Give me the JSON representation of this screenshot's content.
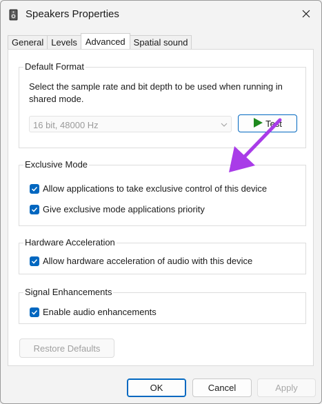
{
  "window": {
    "title": "Speakers Properties"
  },
  "tabs": [
    {
      "label": "General"
    },
    {
      "label": "Levels"
    },
    {
      "label": "Advanced"
    },
    {
      "label": "Spatial sound"
    }
  ],
  "default_format": {
    "title": "Default Format",
    "description": "Select the sample rate and bit depth to be used when running in shared mode.",
    "selected_format": "16 bit, 48000 Hz",
    "test_label": "Test"
  },
  "exclusive_mode": {
    "title": "Exclusive Mode",
    "options": [
      {
        "label": "Allow applications to take exclusive control of this device",
        "checked": true
      },
      {
        "label": "Give exclusive mode applications priority",
        "checked": true
      }
    ]
  },
  "hardware_acceleration": {
    "title": "Hardware Acceleration",
    "options": [
      {
        "label": "Allow hardware acceleration of audio with this device",
        "checked": true
      }
    ]
  },
  "signal_enhancements": {
    "title": "Signal Enhancements",
    "options": [
      {
        "label": "Enable audio enhancements",
        "checked": true
      }
    ]
  },
  "restore_defaults_label": "Restore Defaults",
  "footer": {
    "ok_label": "OK",
    "cancel_label": "Cancel",
    "apply_label": "Apply"
  },
  "colors": {
    "accent": "#0067c0",
    "annotation_arrow": "#a93ce8",
    "test_play": "#1e8a1e"
  }
}
